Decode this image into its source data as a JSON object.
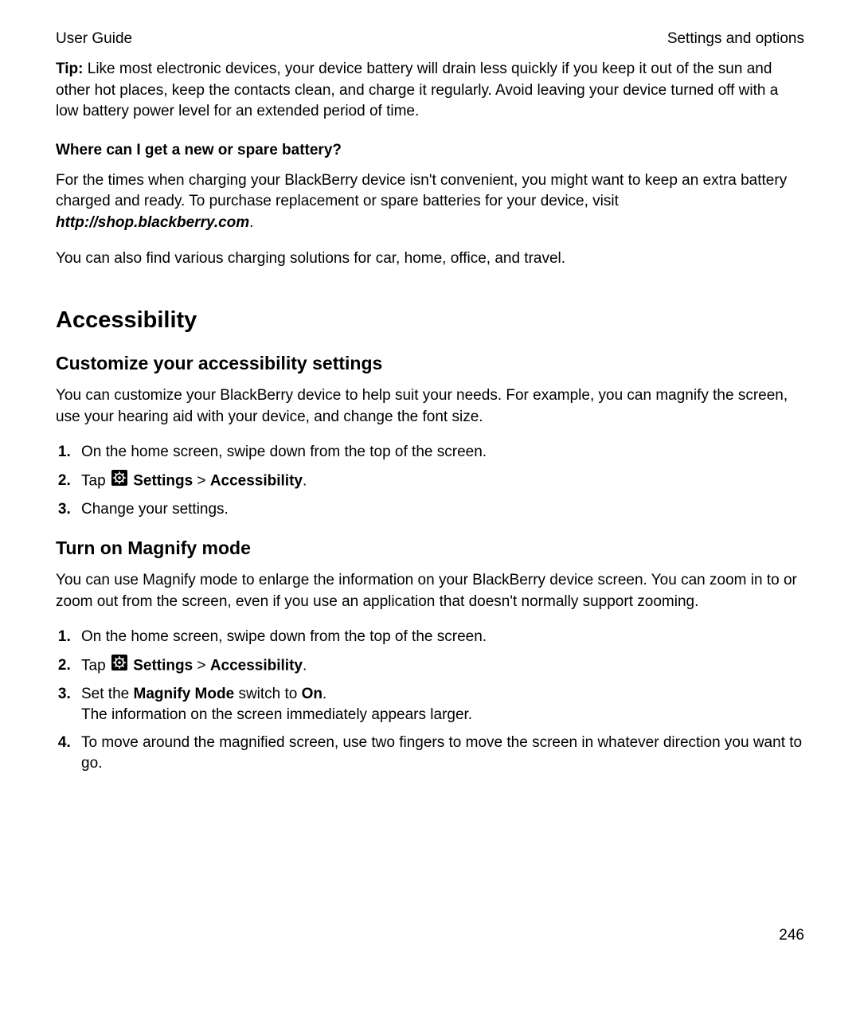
{
  "header": {
    "left": "User Guide",
    "right": "Settings and options"
  },
  "tip": {
    "label": "Tip:",
    "text": " Like most electronic devices, your device battery will drain less quickly if you keep it out of the sun and other hot places, keep the contacts clean, and charge it regularly. Avoid leaving your device turned off with a low battery power level for an extended period of time."
  },
  "battery": {
    "heading": "Where can I get a new or spare battery?",
    "p1_a": "For the times when charging your BlackBerry device isn't convenient, you might want to keep an extra battery charged and ready. To purchase replacement or spare batteries for your device, visit ",
    "p1_link": "http://shop.blackberry.com",
    "p1_b": ".",
    "p2": "You can also find various charging solutions for car, home, office, and travel."
  },
  "accessibility": {
    "title": "Accessibility",
    "customize": {
      "heading": "Customize your accessibility settings",
      "intro": "You can customize your BlackBerry device to help suit your needs. For example, you can magnify the screen, use your hearing aid with your device, and change the font size.",
      "step1": "On the home screen, swipe down from the top of the screen.",
      "step2_a": "Tap ",
      "step2_b": " Settings",
      "step2_c": " > ",
      "step2_d": "Accessibility",
      "step2_e": ".",
      "step3": "Change your settings."
    },
    "magnify": {
      "heading": "Turn on Magnify mode",
      "intro": "You can use Magnify mode to enlarge the information on your BlackBerry device screen. You can zoom in to or zoom out from the screen, even if you use an application that doesn't normally support zooming.",
      "step1": "On the home screen, swipe down from the top of the screen.",
      "step2_a": "Tap ",
      "step2_b": " Settings",
      "step2_c": " > ",
      "step2_d": "Accessibility",
      "step2_e": ".",
      "step3_a": "Set the ",
      "step3_b": "Magnify Mode",
      "step3_c": " switch to ",
      "step3_d": "On",
      "step3_e": ".",
      "step3_note": "The information on the screen immediately appears larger.",
      "step4": "To move around the magnified screen, use two fingers to move the screen in whatever direction you want to go."
    }
  },
  "page_number": "246"
}
